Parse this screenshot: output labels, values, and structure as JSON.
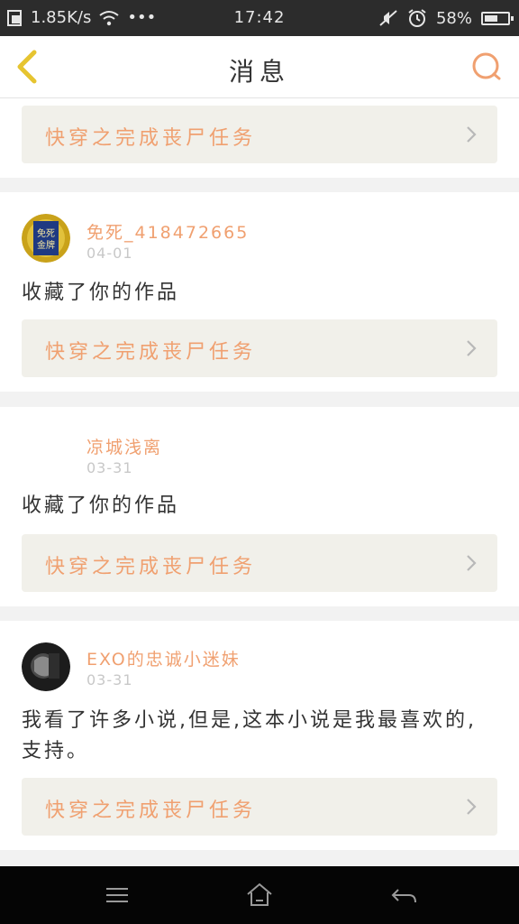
{
  "status_bar": {
    "network_speed": "1.85K/s",
    "dots": "•••",
    "time": "17:42",
    "battery_percent": "58%",
    "battery_level": 0.58
  },
  "header": {
    "title": "消息",
    "back_icon": "chevron-left-icon",
    "search_icon": "search-icon"
  },
  "messages": [
    {
      "work_title": "快穿之完成丧尸任务"
    },
    {
      "username": "免死_418472665",
      "date": "04-01",
      "text": "收藏了你的作品",
      "work_title": "快穿之完成丧尸任务",
      "avatar_text": "免死金牌"
    },
    {
      "username": "凉城浅离",
      "date": "03-31",
      "text": "收藏了你的作品",
      "work_title": "快穿之完成丧尸任务"
    },
    {
      "username": "EXO的忠诚小迷妹",
      "date": "03-31",
      "text": "我看了许多小说,但是,这本小说是我最喜欢的,支持。",
      "work_title": "快穿之完成丧尸任务"
    }
  ],
  "nav": [
    "menu-icon",
    "home-icon",
    "back-icon"
  ],
  "colors": {
    "accent": "#f0a070",
    "link_bg": "#f1f0ea",
    "back_arrow": "#e6c430",
    "status_bar": "#2c2c2c",
    "nav_bar": "#050505"
  }
}
